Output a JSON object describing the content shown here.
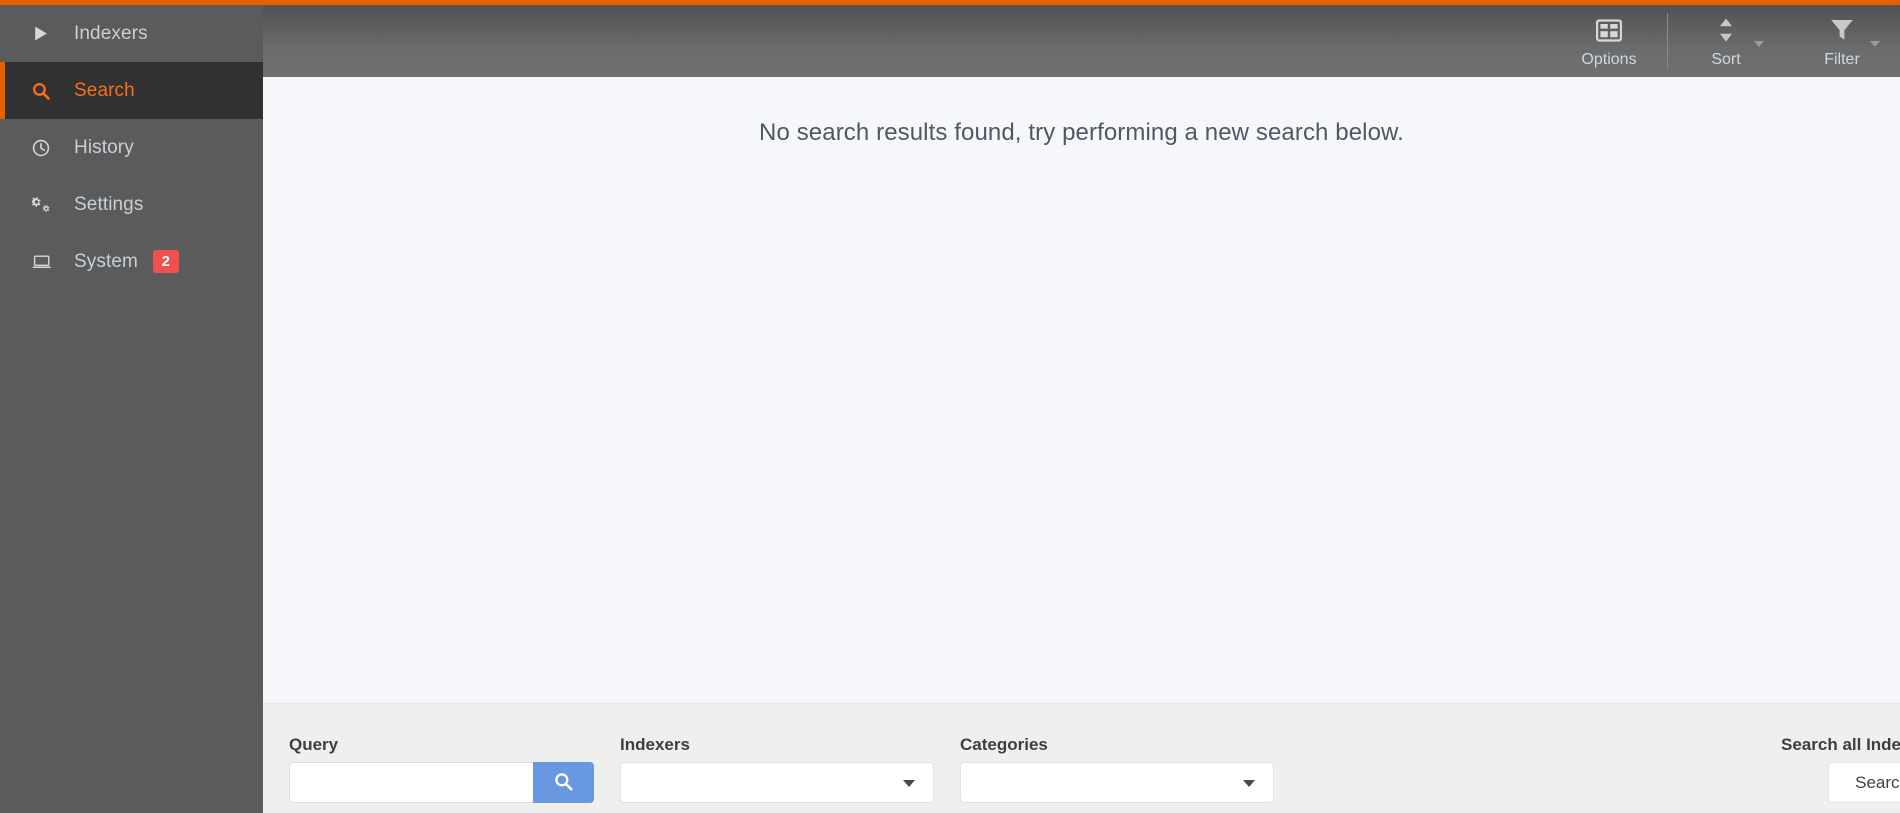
{
  "theme": {
    "accent": "#e66000",
    "active_text": "#f96f1b",
    "sidebar_bg": "#5b5b5b",
    "sidebar_active_bg": "#313131",
    "header_bg": "#6c6c6c",
    "content_bg": "#f5f7fa",
    "panel_bg": "#efefed",
    "badge_bg": "#f05050",
    "query_button_bg": "#6899e0"
  },
  "sidebar": {
    "items": [
      {
        "label": "Indexers",
        "icon": "play-icon",
        "active": false,
        "badge": null
      },
      {
        "label": "Search",
        "icon": "search-icon",
        "active": true,
        "badge": null
      },
      {
        "label": "History",
        "icon": "clock-icon",
        "active": false,
        "badge": null
      },
      {
        "label": "Settings",
        "icon": "cogs-icon",
        "active": false,
        "badge": null
      },
      {
        "label": "System",
        "icon": "laptop-icon",
        "active": false,
        "badge": "2"
      }
    ]
  },
  "toolbar": {
    "buttons": [
      {
        "label": "Options",
        "icon": "table-icon",
        "has_caret": false
      },
      {
        "label": "Sort",
        "icon": "sort-icon",
        "has_caret": true
      },
      {
        "label": "Filter",
        "icon": "filter-icon",
        "has_caret": true
      }
    ]
  },
  "main": {
    "no_results_message": "No search results found, try performing a new search below."
  },
  "search_panel": {
    "query": {
      "label": "Query",
      "value": "",
      "placeholder": "",
      "button_icon": "search-icon"
    },
    "indexers": {
      "label": "Indexers",
      "value": "",
      "placeholder": ""
    },
    "categories": {
      "label": "Categories",
      "value": "",
      "placeholder": ""
    },
    "search_all": {
      "label": "Search all Indexers",
      "button_label": "Search"
    }
  }
}
